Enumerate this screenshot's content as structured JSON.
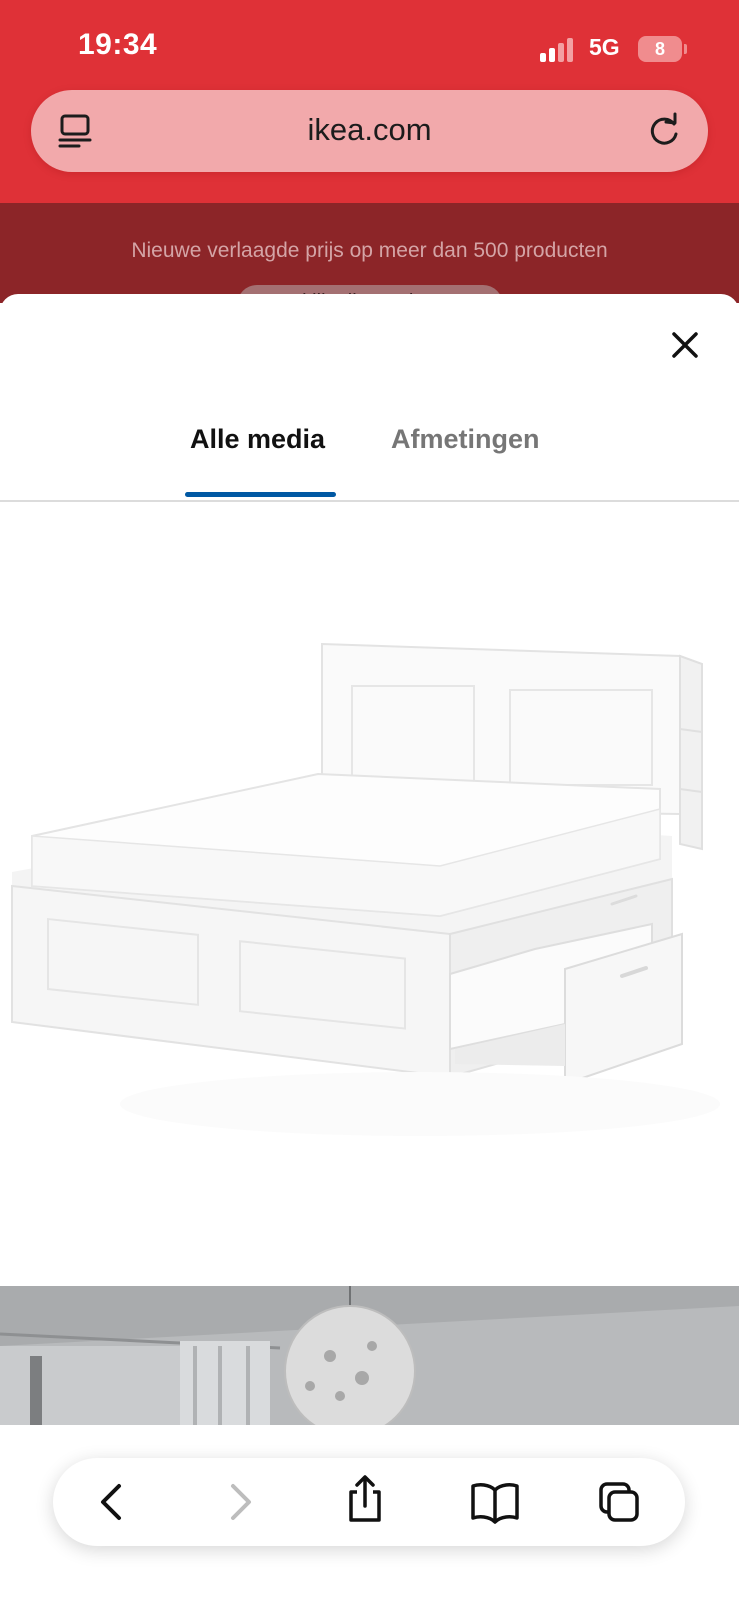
{
  "status_bar": {
    "time": "19:34",
    "network": "5G",
    "battery": "8"
  },
  "browser": {
    "url": "ikea.com",
    "icons": [
      "reader-menu-icon",
      "reload-icon"
    ]
  },
  "page_banner": {
    "text": "Nieuwe verlaagde prijs op meer dan 500 producten",
    "button_label": "Bekijk alle producten"
  },
  "modal": {
    "tabs": [
      {
        "label": "Alle media",
        "active": true
      },
      {
        "label": "Afmetingen",
        "active": false
      }
    ],
    "close_icon": "close-icon",
    "accent_color": "#0058a3"
  },
  "toolbar": {
    "icons": [
      "back-icon",
      "forward-icon",
      "share-icon",
      "bookmarks-icon",
      "tabs-icon"
    ]
  },
  "colors": {
    "brand_red": "#df3137",
    "banner_dark_red": "#8c2528"
  }
}
